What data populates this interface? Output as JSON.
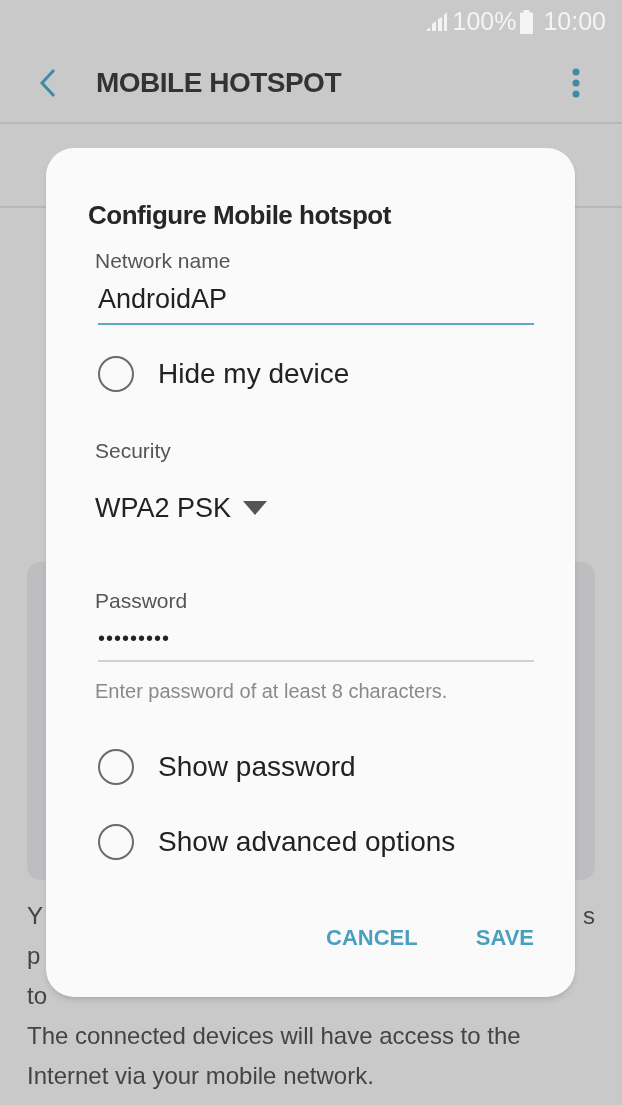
{
  "status_bar": {
    "battery": "100%",
    "time": "10:00"
  },
  "app_bar": {
    "title": "MOBILE HOTSPOT"
  },
  "background_text": {
    "row_1": [
      "Y",
      "s"
    ],
    "row_2": "p",
    "row_3": "to",
    "row_4": "The connected devices will have access to the",
    "row_5": "Internet via your mobile network."
  },
  "dialog": {
    "title": "Configure Mobile hotspot",
    "network_name": {
      "label": "Network name",
      "value": "AndroidAP"
    },
    "hide_device": {
      "label": "Hide my device",
      "checked": false
    },
    "security": {
      "label": "Security",
      "value": "WPA2 PSK"
    },
    "password": {
      "label": "Password",
      "value": "•••••••••",
      "hint": "Enter password of at least 8 characters."
    },
    "options": [
      {
        "label": "Show password",
        "checked": false
      },
      {
        "label": "Show advanced options",
        "checked": false
      }
    ],
    "buttons": [
      "CANCEL",
      "SAVE"
    ]
  }
}
